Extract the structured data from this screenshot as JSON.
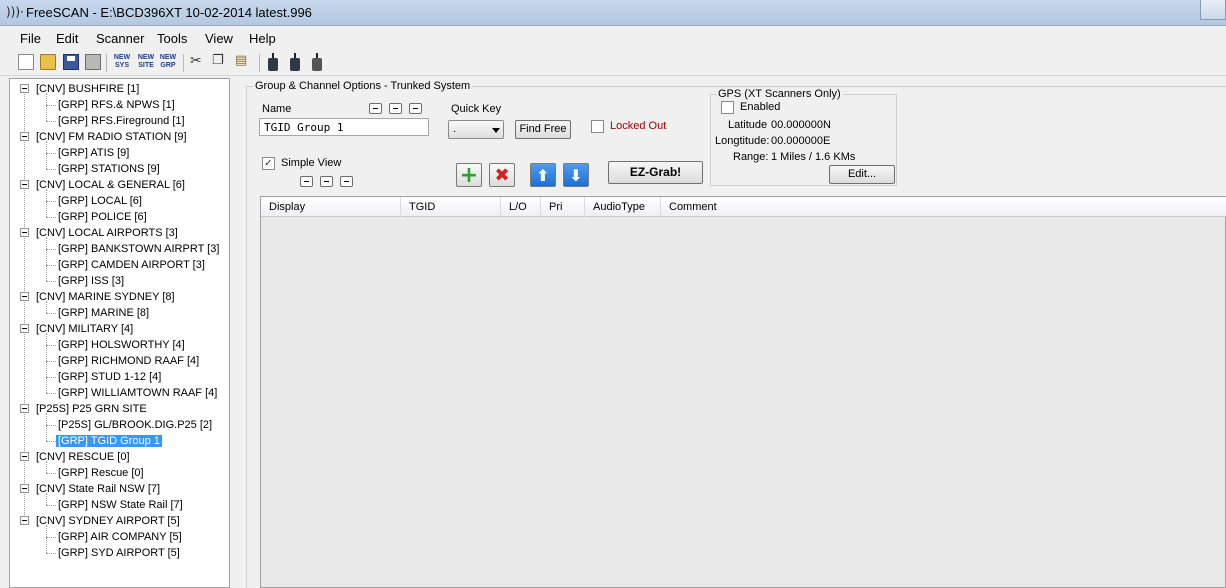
{
  "window": {
    "title": "FreeSCAN - E:\\BCD396XT 10-02-2014 latest.996",
    "app_icon": "radio-waves-icon"
  },
  "menu": [
    "File",
    "Edit",
    "Scanner",
    "Tools",
    "View",
    "Help"
  ],
  "toolbar": {
    "new_sys_top": "NEW",
    "new_sys_bottom": "SYS",
    "new_site_top": "NEW",
    "new_site_bottom": "SITE",
    "new_grp_top": "NEW",
    "new_grp_bottom": "GRP"
  },
  "tree": [
    {
      "label": "[CNV] BUSHFIRE [1]",
      "level": 0
    },
    {
      "label": "[GRP] RFS.& NPWS [1]",
      "level": 1
    },
    {
      "label": "[GRP] RFS.Fireground [1]",
      "level": 1
    },
    {
      "label": "[CNV] FM RADIO STATION [9]",
      "level": 0
    },
    {
      "label": "[GRP] ATIS [9]",
      "level": 1
    },
    {
      "label": "[GRP] STATIONS [9]",
      "level": 1
    },
    {
      "label": "[CNV] LOCAL & GENERAL [6]",
      "level": 0
    },
    {
      "label": "[GRP] LOCAL [6]",
      "level": 1
    },
    {
      "label": "[GRP] POLICE [6]",
      "level": 1
    },
    {
      "label": "[CNV] LOCAL AIRPORTS [3]",
      "level": 0
    },
    {
      "label": "[GRP] BANKSTOWN AIRPRT [3]",
      "level": 1
    },
    {
      "label": "[GRP] CAMDEN AIRPORT [3]",
      "level": 1
    },
    {
      "label": "[GRP] ISS [3]",
      "level": 1
    },
    {
      "label": "[CNV] MARINE SYDNEY [8]",
      "level": 0
    },
    {
      "label": "[GRP] MARINE [8]",
      "level": 1
    },
    {
      "label": "[CNV] MILITARY [4]",
      "level": 0
    },
    {
      "label": "[GRP] HOLSWORTHY [4]",
      "level": 1
    },
    {
      "label": "[GRP] RICHMOND RAAF [4]",
      "level": 1
    },
    {
      "label": "[GRP] STUD 1-12 [4]",
      "level": 1
    },
    {
      "label": "[GRP] WILLIAMTOWN RAAF [4]",
      "level": 1
    },
    {
      "label": "[P25S] P25 GRN SITE",
      "level": 0
    },
    {
      "label": "[P25S] GL/BROOK.DIG.P25 [2]",
      "level": 1
    },
    {
      "label": "[GRP] TGID Group 1",
      "level": 1,
      "selected": true
    },
    {
      "label": "[CNV] RESCUE [0]",
      "level": 0
    },
    {
      "label": "[GRP] Rescue [0]",
      "level": 1
    },
    {
      "label": "[CNV] State Rail NSW [7]",
      "level": 0
    },
    {
      "label": "[GRP] NSW State Rail [7]",
      "level": 1
    },
    {
      "label": "[CNV] SYDNEY AIRPORT [5]",
      "level": 0
    },
    {
      "label": "[GRP] AIR COMPANY [5]",
      "level": 1
    },
    {
      "label": "[GRP] SYD AIRPORT [5]",
      "level": 1
    }
  ],
  "panel": {
    "title": "Group & Channel Options - Trunked System",
    "name_label": "Name",
    "name_value": "TGID Group 1",
    "quick_key_label": "Quick Key",
    "quick_key_value": ".",
    "find_free": "Find Free",
    "locked_out": "Locked Out",
    "locked_out_color": "#a00000",
    "simple_view": "Simple View",
    "ez_grab": "EZ-Grab!"
  },
  "gps": {
    "title": "GPS (XT Scanners Only)",
    "enabled": "Enabled",
    "latitude_label": "Latitude",
    "latitude_value": "00.000000N",
    "longitude_label": "Longtitude:",
    "longitude_value": "00.000000E",
    "range_label": "Range:",
    "range_value": "1 Miles / 1.6 KMs",
    "edit": "Edit..."
  },
  "grid": {
    "columns": [
      "Display",
      "TGID",
      "L/O",
      "Pri",
      "AudioType",
      "Comment"
    ]
  },
  "icons": {
    "add": "plus-icon",
    "delete": "x-icon",
    "up": "arrow-up-icon",
    "down": "arrow-down-icon",
    "colors": {
      "add": "#2e9e2e",
      "delete": "#d62020",
      "arrows": "#1f6fd1",
      "selected": "#3399ff"
    }
  }
}
